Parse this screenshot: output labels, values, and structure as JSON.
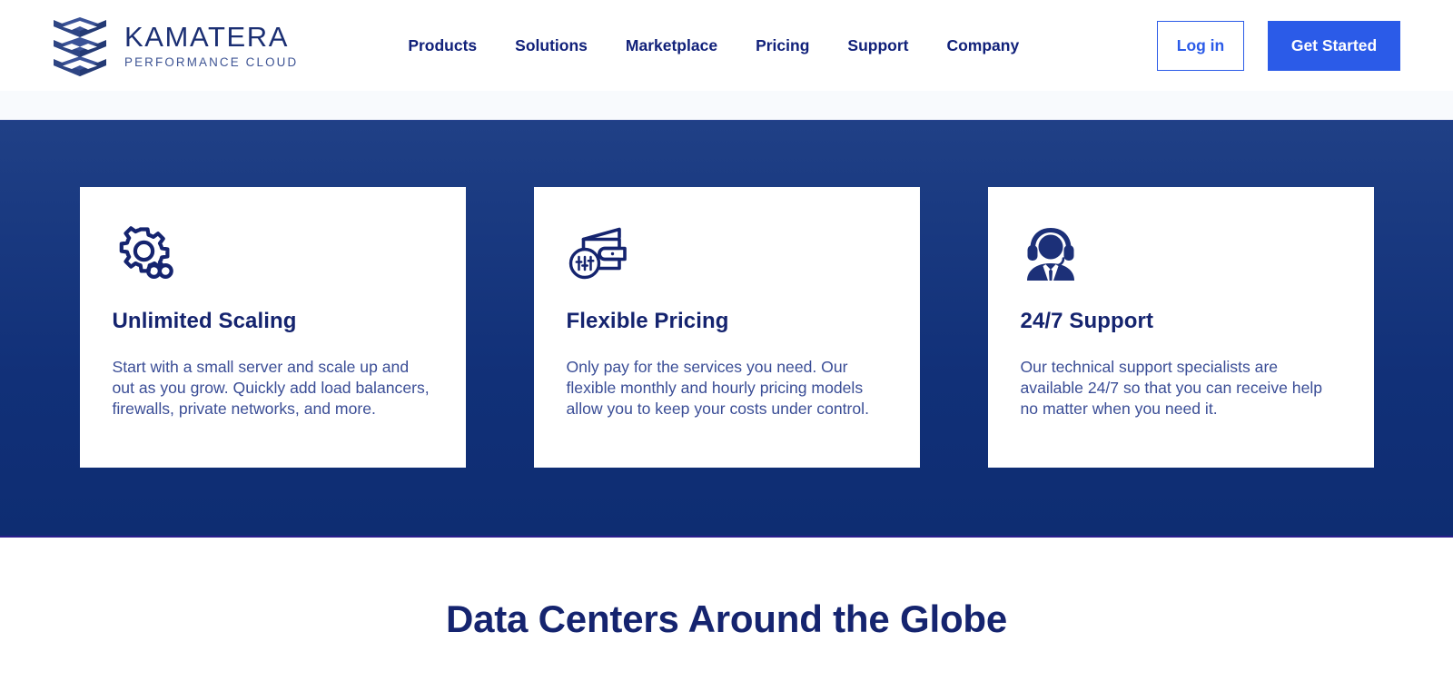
{
  "header": {
    "logo": {
      "icon": "stacked-layers-logo",
      "name": "KAMATERA",
      "tagline": "PERFORMANCE CLOUD"
    },
    "nav": [
      {
        "label": "Products"
      },
      {
        "label": "Solutions"
      },
      {
        "label": "Marketplace"
      },
      {
        "label": "Pricing"
      },
      {
        "label": "Support"
      },
      {
        "label": "Company"
      }
    ],
    "login_label": "Log in",
    "get_started_label": "Get Started"
  },
  "features": [
    {
      "icon": "gear-infinity-icon",
      "title": "Unlimited Scaling",
      "body": "Start with a small server and scale up and out as you grow. Quickly add load balancers, firewalls, private networks, and more."
    },
    {
      "icon": "wallet-sliders-icon",
      "title": "Flexible Pricing",
      "body": "Only pay for the services you need. Our flexible monthly and hourly pricing models allow you to keep your costs under control."
    },
    {
      "icon": "support-agent-headset-icon",
      "title": "24/7 Support",
      "body": "Our technical support specialists are available 24/7 so that you can receive help no matter when you need it."
    }
  ],
  "globe_section": {
    "title": "Data Centers Around the Globe"
  },
  "colors": {
    "brand_navy": "#15246f",
    "accent_blue": "#2b5be8",
    "section_blue_top": "#204086",
    "section_blue_bottom": "#0e2d72",
    "body_text_blue": "#3a4d96",
    "card_white": "#ffffff",
    "strip_gray": "#f8fafd"
  }
}
